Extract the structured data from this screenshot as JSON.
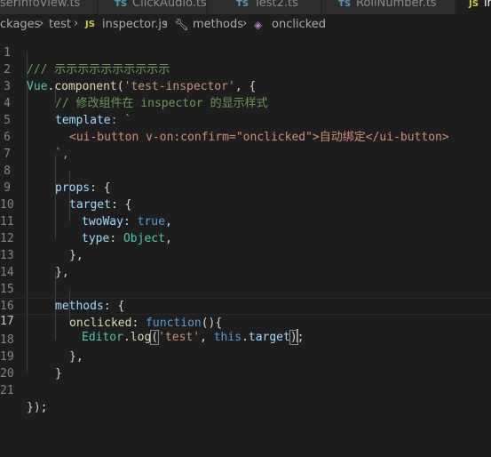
{
  "tabs": [
    {
      "badge": "",
      "label": "oserInfoView.ts",
      "active": false
    },
    {
      "badge": "TS",
      "label": "ClickAudio.ts",
      "active": false
    },
    {
      "badge": "TS",
      "label": "Test2.ts",
      "active": false
    },
    {
      "badge": "TS",
      "label": "RollNumber.ts",
      "active": false
    },
    {
      "badge": "JS",
      "label": "in",
      "active": true
    }
  ],
  "breadcrumb": {
    "segments": [
      "ckages",
      "test",
      "inspector.js",
      "methods",
      "onclicked"
    ],
    "js_badge": "JS"
  },
  "editor": {
    "line_numbers": [
      "1",
      "2",
      "3",
      "4",
      "5",
      "6",
      "7",
      "8",
      "9",
      "10",
      "11",
      "12",
      "13",
      "14",
      "15",
      "16",
      "17",
      "18",
      "19",
      "20",
      "21"
    ],
    "lines": {
      "l1": "/// 示示示示示示示示示示",
      "l2a": "Vue",
      "l2b": ".",
      "l2c": "component",
      "l2d": "(",
      "l2e": "'test-inspector'",
      "l2f": ", {",
      "l3": "// 修改组件在 inspector 的显示样式",
      "l4a": "template",
      "l4b": ": `",
      "l5": "<ui-button v-on:confirm=\"onclicked\">自动绑定</ui-button>",
      "l6": "`,",
      "l8a": "props",
      "l8b": ": {",
      "l9a": "target",
      "l9b": ": {",
      "l10a": "twoWay",
      "l10b": ": ",
      "l10c": "true",
      "l10d": ",",
      "l11a": "type",
      "l11b": ": ",
      "l11c": "Object",
      "l11d": ",",
      "l12": "},",
      "l13": "},",
      "l15a": "methods",
      "l15b": ": {",
      "l16a": "onclicked",
      "l16b": ": ",
      "l16c": "function",
      "l16d": "(){",
      "l17a": "Editor",
      "l17b": ".",
      "l17c": "log",
      "l17d": "(",
      "l17e": "'test'",
      "l17f": ", ",
      "l17g": "this",
      "l17h": ".",
      "l17i": "target",
      "l17j": ")",
      "l17k": ";",
      "l18": "},",
      "l19": "}",
      "l21": "});"
    }
  },
  "colors": {
    "background": "#1e1e1e",
    "comment": "#6a9955",
    "keyword": "#569cd6",
    "string": "#ce9178",
    "function": "#dcdcaa",
    "variable": "#9cdcfe",
    "type": "#4ec9b0"
  }
}
